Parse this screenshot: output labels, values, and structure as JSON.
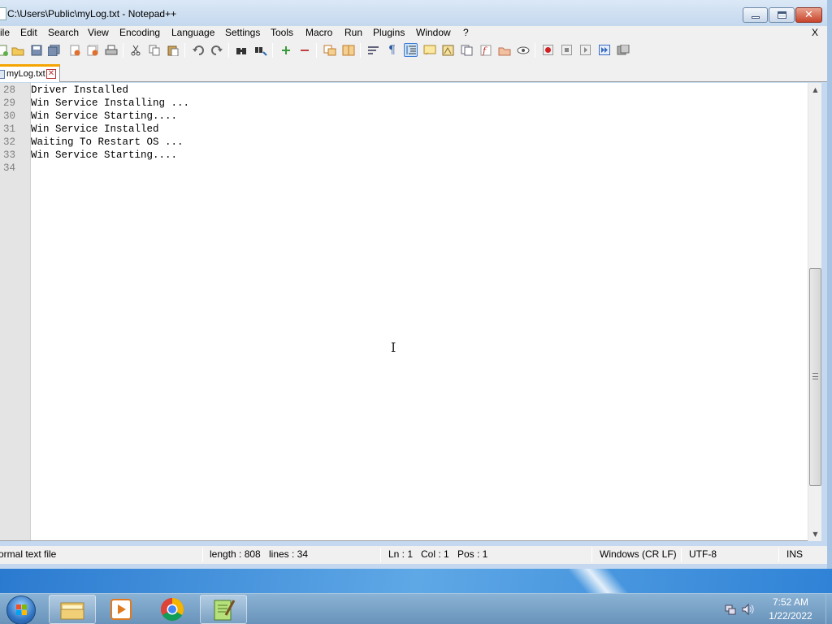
{
  "window": {
    "title": "C:\\Users\\Public\\myLog.txt - Notepad++"
  },
  "menu": {
    "items": [
      "ile",
      "Edit",
      "Search",
      "View",
      "Encoding",
      "Language",
      "Settings",
      "Tools",
      "Macro",
      "Run",
      "Plugins",
      "Window",
      "?"
    ],
    "close_doc": "X"
  },
  "tab": {
    "label": "myLog.txt"
  },
  "editor": {
    "lines": [
      {
        "no": "28",
        "text": "Driver Installed"
      },
      {
        "no": "29",
        "text": "Win Service Installing ..."
      },
      {
        "no": "30",
        "text": "Win Service Starting...."
      },
      {
        "no": "31",
        "text": "Win Service Installed"
      },
      {
        "no": "32",
        "text": "Waiting To Restart OS ..."
      },
      {
        "no": "33",
        "text": "Win Service Starting...."
      },
      {
        "no": "34",
        "text": ""
      }
    ]
  },
  "status": {
    "file_type": "ormal text file",
    "length": "length : 808",
    "lines": "lines : 34",
    "ln": "Ln : 1",
    "col": "Col : 1",
    "pos": "Pos : 1",
    "eol": "Windows (CR LF)",
    "encoding": "UTF-8",
    "mode": "INS"
  },
  "taskbar": {
    "time": "7:52 AM",
    "date": "1/22/2022"
  },
  "colors": {
    "tab_accent": "#f5a400",
    "titlebar": "#c4d8ee",
    "close_button": "#c8442b",
    "taskbar": "#6993ba"
  },
  "icons": [
    "new-file-icon",
    "open-file-icon",
    "save-icon",
    "save-all-icon",
    "close-icon",
    "close-all-icon",
    "print-icon",
    "cut-icon",
    "copy-icon",
    "paste-icon",
    "undo-icon",
    "redo-icon",
    "find-icon",
    "replace-icon",
    "zoom-in-icon",
    "zoom-out-icon",
    "sync-vertical-icon",
    "sync-horizontal-icon",
    "word-wrap-icon",
    "show-all-chars-icon",
    "indent-guide-icon",
    "udl-icon",
    "doc-map-icon",
    "doc-list-icon",
    "function-list-icon",
    "folder-workspace-icon",
    "monitoring-icon",
    "record-macro-icon",
    "stop-macro-icon",
    "play-macro-icon",
    "run-macro-multiple-icon",
    "save-macro-icon"
  ]
}
